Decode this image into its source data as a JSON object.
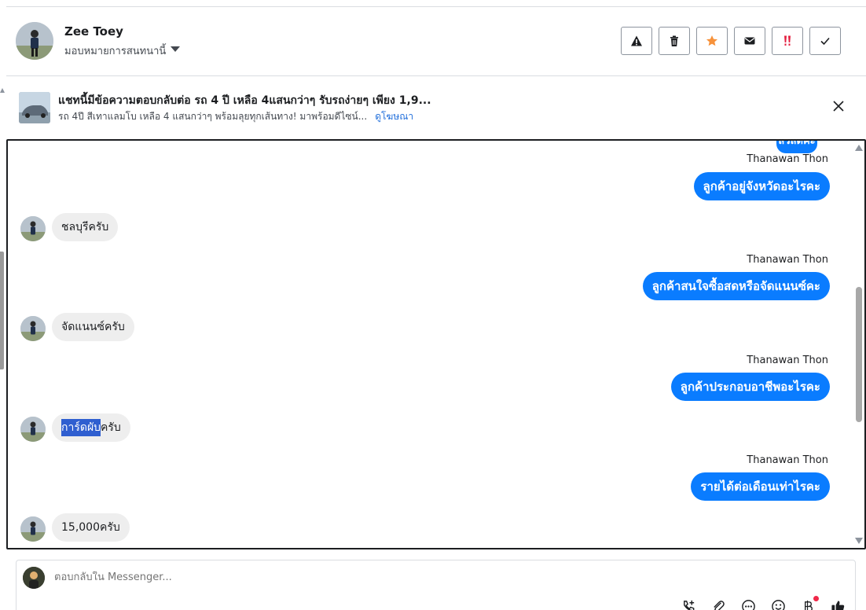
{
  "header": {
    "contact_name": "Zee Toey",
    "assign_label": "มอบหมายการสนทนานี้",
    "actions": [
      {
        "name": "report-button",
        "icon": "warning-icon"
      },
      {
        "name": "delete-button",
        "icon": "trash-icon"
      },
      {
        "name": "star-button",
        "icon": "star-icon",
        "color": "#f7923b"
      },
      {
        "name": "mark-unread-button",
        "icon": "envelope-icon"
      },
      {
        "name": "spam-button",
        "icon": "double-exclamation-icon",
        "color": "#e41e3f"
      },
      {
        "name": "done-button",
        "icon": "check-icon"
      }
    ]
  },
  "ad": {
    "title": "แชทนี้มีข้อความตอบกลับต่อ รถ 4 ปี เหลือ 4แสนกว่าๆ รับรถง่ายๆ เพียง 1,9...",
    "subtitle": "รถ 4ปี สีเทาแลมโบ เหลือ 4 แสนกว่าๆ พร้อมลุยทุกเส้นทาง! มาพร้อมดีไซน์...",
    "link_label": "ดูโฆษณา"
  },
  "thread": {
    "partial_top_text": "สวัสดีค่ะ",
    "messages": [
      {
        "direction": "out",
        "sender": "Thanawan Thon",
        "text": "ลูกค้าอยู่จังหวัดอะไรคะ"
      },
      {
        "direction": "in",
        "text": "ชลบุรีครับ"
      },
      {
        "direction": "out",
        "sender": "Thanawan Thon",
        "text": "ลูกค้าสนใจซื้อสดหรือจัดแนนซ์คะ"
      },
      {
        "direction": "in",
        "text": "จัดแนนซ์ครับ"
      },
      {
        "direction": "out",
        "sender": "Thanawan Thon",
        "text": "ลูกค้าประกอบอาชีพอะไรคะ"
      },
      {
        "direction": "in",
        "text_highlight": "การ์ดผับ",
        "text_rest": "ครับ"
      },
      {
        "direction": "out",
        "sender": "Thanawan Thon",
        "text": "รายได้ต่อเดือนเท่าไรคะ"
      },
      {
        "direction": "in",
        "text": "15,000ครับ"
      }
    ]
  },
  "composer": {
    "placeholder": "ตอบกลับใน Messenger...",
    "tools": [
      "call-add-icon",
      "paperclip-icon",
      "more-icon",
      "emoji-icon",
      "baht-icon",
      "thumbs-up-icon"
    ],
    "accent": "#0a7cff"
  }
}
